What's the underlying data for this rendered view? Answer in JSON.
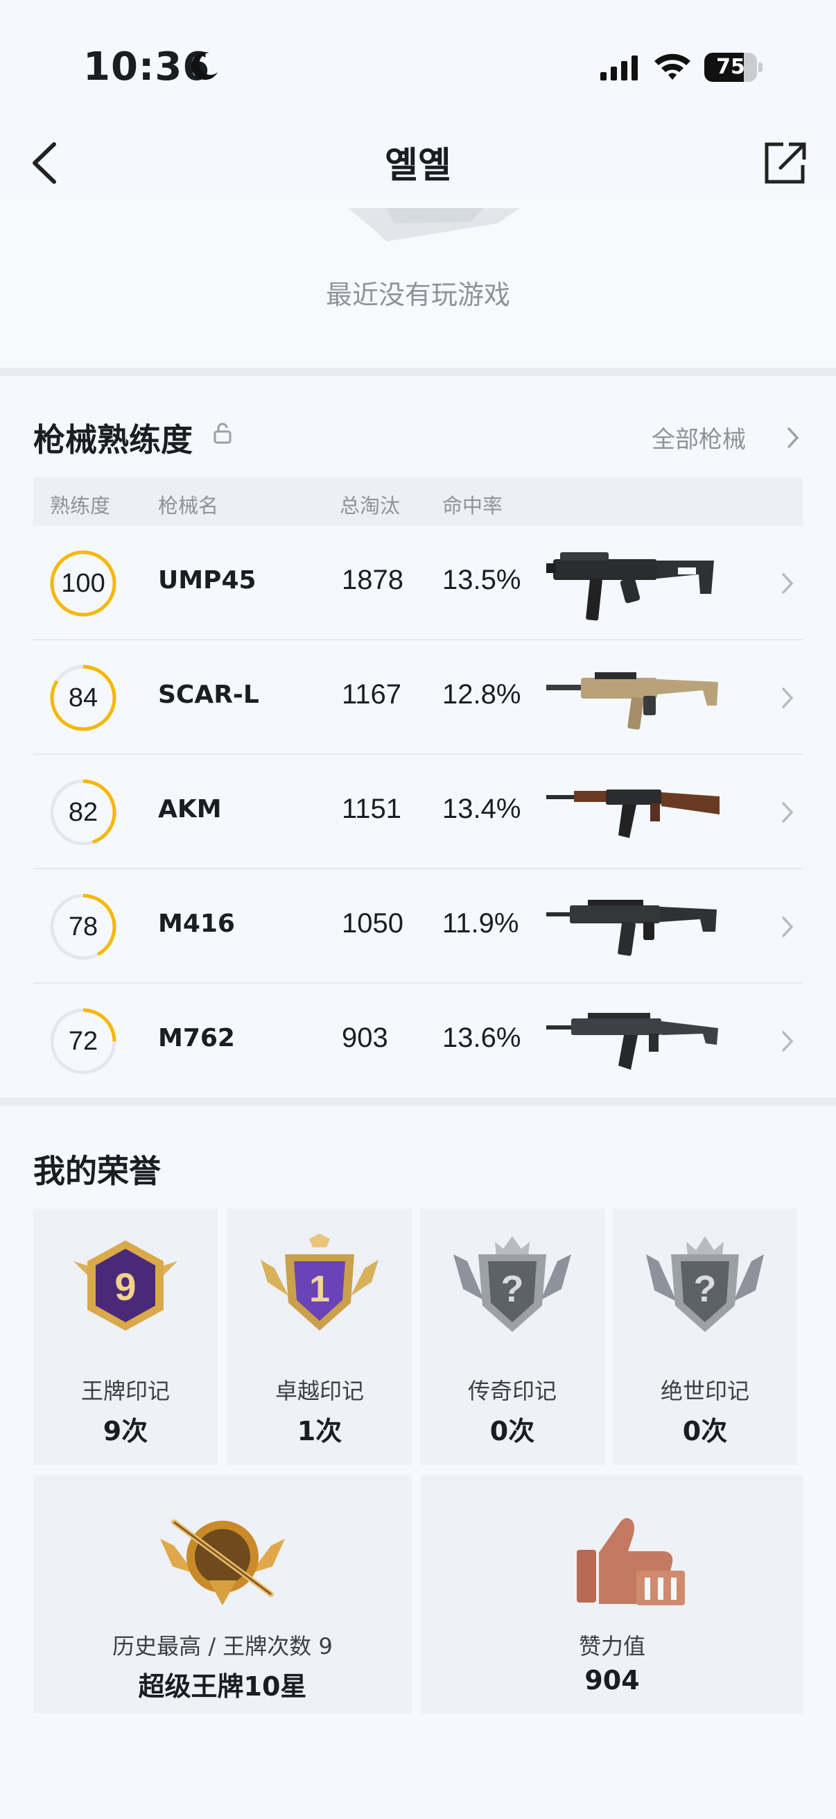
{
  "status_bar": {
    "time": "10:36",
    "battery_level": "75",
    "battery_fraction": 0.75
  },
  "nav": {
    "title": "옐옐"
  },
  "recent": {
    "message": "最近没有玩游戏"
  },
  "weapons": {
    "title": "枪械熟练度",
    "all_link": "全部枪械",
    "columns": [
      "熟练度",
      "枪械名",
      "总淘汰",
      "命中率"
    ],
    "rows": [
      {
        "proficiency": "100",
        "proficiency_fraction": 1.0,
        "name": "UMP45",
        "kills": "1878",
        "accuracy": "13.5%",
        "icon": "ump45-gun-icon"
      },
      {
        "proficiency": "84",
        "proficiency_fraction": 0.84,
        "name": "SCAR-L",
        "kills": "1167",
        "accuracy": "12.8%",
        "icon": "scar-l-gun-icon"
      },
      {
        "proficiency": "82",
        "proficiency_fraction": 0.45,
        "name": "AKM",
        "kills": "1151",
        "accuracy": "13.4%",
        "icon": "akm-gun-icon"
      },
      {
        "proficiency": "78",
        "proficiency_fraction": 0.42,
        "name": "M416",
        "kills": "1050",
        "accuracy": "11.9%",
        "icon": "m416-gun-icon"
      },
      {
        "proficiency": "72",
        "proficiency_fraction": 0.25,
        "name": "M762",
        "kills": "903",
        "accuracy": "13.6%",
        "icon": "m762-gun-icon"
      }
    ]
  },
  "honors": {
    "title": "我的荣誉",
    "cards": [
      {
        "name": "王牌印记",
        "count": "9次",
        "badge_number": "9",
        "icon": "ace-mark-badge-icon"
      },
      {
        "name": "卓越印记",
        "count": "1次",
        "badge_number": "1",
        "icon": "excellence-mark-badge-icon"
      },
      {
        "name": "传奇印记",
        "count": "0次",
        "badge_number": "?",
        "icon": "legend-mark-badge-icon"
      },
      {
        "name": "绝世印记",
        "count": "0次",
        "badge_number": "?",
        "icon": "peerless-mark-badge-icon"
      }
    ],
    "highest": {
      "label": "历史最高 / 王牌次数 9",
      "value": "超级王牌10星",
      "icon": "super-ace-badge-icon"
    },
    "likes": {
      "label": "赞力值",
      "value": "904",
      "icon": "thumbs-up-icon"
    }
  },
  "colors": {
    "accent": "#f5b800",
    "background": "#f5f8fc",
    "card": "#eef1f5",
    "muted_text": "#8e939b"
  }
}
